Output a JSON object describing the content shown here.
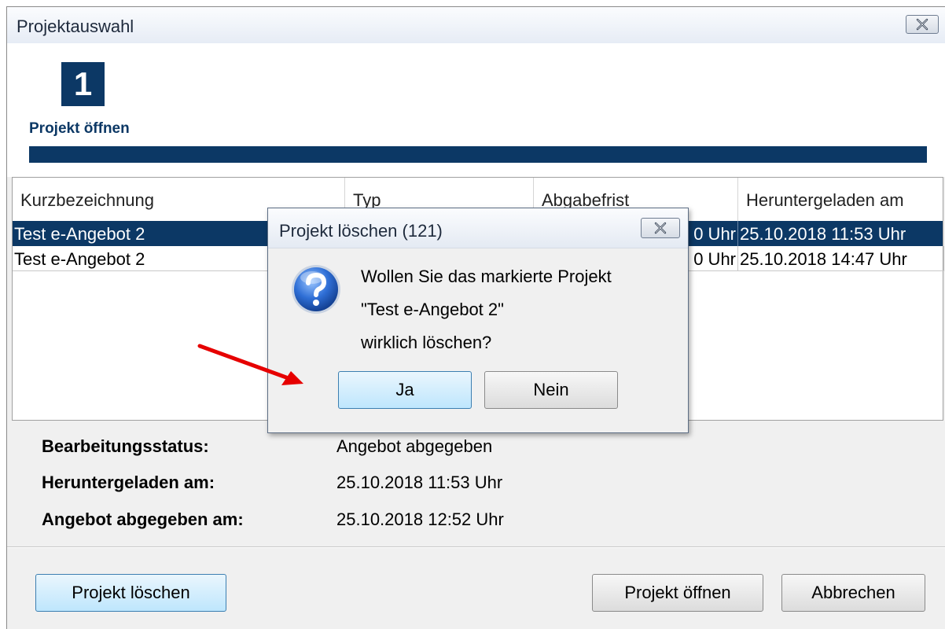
{
  "window": {
    "title": "Projektauswahl",
    "step_number": "1",
    "step_label": "Projekt öffnen"
  },
  "table": {
    "columns": [
      "Kurzbezeichnung",
      "Typ",
      "Abgabefrist",
      "Heruntergeladen am"
    ],
    "rows": [
      {
        "kurz": "Test e-Angebot 2",
        "typ": "",
        "frist": "0 Uhr",
        "heruntergeladen": "25.10.2018 11:53 Uhr",
        "selected": true
      },
      {
        "kurz": "Test e-Angebot 2",
        "typ": "",
        "frist": "0 Uhr",
        "heruntergeladen": "25.10.2018 14:47 Uhr",
        "selected": false
      }
    ]
  },
  "details": {
    "status_label": "Bearbeitungsstatus:",
    "status_value": "Angebot abgegeben",
    "downloaded_label": "Heruntergeladen am:",
    "downloaded_value": "25.10.2018 11:53 Uhr",
    "submitted_label": "Angebot abgegeben am:",
    "submitted_value": "25.10.2018 12:52 Uhr"
  },
  "buttons": {
    "delete": "Projekt löschen",
    "open": "Projekt öffnen",
    "cancel": "Abbrechen"
  },
  "dialog": {
    "title": "Projekt löschen (121)",
    "message_line1": "Wollen Sie das markierte Projekt",
    "message_line2": "\"Test e-Angebot 2\"",
    "message_line3": "wirklich löschen?",
    "yes": "Ja",
    "no": "Nein"
  },
  "colors": {
    "accent": "#0c3865",
    "annotation_arrow": "#e60000",
    "focus_button": "#bee6fd"
  },
  "icons": [
    "close-icon",
    "question-icon",
    "red-arrow-annotation"
  ]
}
